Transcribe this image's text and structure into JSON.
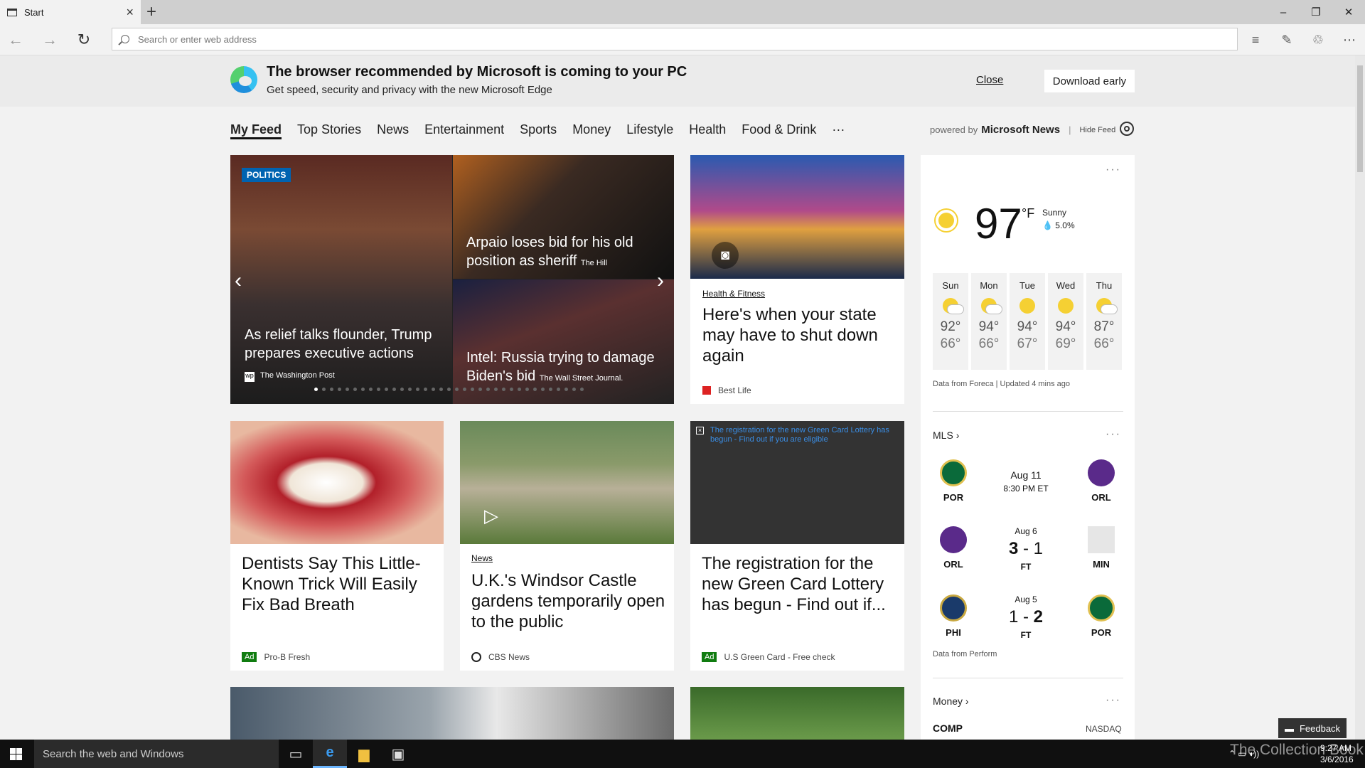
{
  "window": {
    "tab_title": "Start",
    "minimize": "–",
    "maximize": "❐",
    "close": "✕"
  },
  "address": {
    "placeholder": "Search or enter web address"
  },
  "banner": {
    "title": "The browser recommended by Microsoft is coming to your PC",
    "subtitle": "Get speed, security and privacy with the new Microsoft Edge",
    "close_label": "Close",
    "download_label": "Download early"
  },
  "feed_nav": {
    "items": [
      "My Feed",
      "Top Stories",
      "News",
      "Entertainment",
      "Sports",
      "Money",
      "Lifestyle",
      "Health",
      "Food & Drink",
      "···"
    ],
    "powered_by": "powered by",
    "provider": "Microsoft News",
    "hide_feed": "Hide Feed"
  },
  "hero": {
    "tag": "POLITICS",
    "main_caption": "As relief talks flounder, Trump prepares executive actions",
    "main_source": "The Washington Post",
    "top_caption": "Arpaio loses bid for his old position as sheriff",
    "top_source": "The Hill",
    "bottom_caption": "Intel: Russia trying to damage Biden's bid",
    "bottom_source": "The Wall Street Journal."
  },
  "cards": {
    "c1": {
      "category": "Health & Fitness",
      "headline": "Here's when your state may have to shut down again",
      "source": "Best Life"
    },
    "c2": {
      "ad": "Ad",
      "headline": "Dentists Say This Little-Known Trick Will Easily Fix Bad Breath",
      "source": "Pro-B Fresh"
    },
    "c3": {
      "category": "News",
      "headline": "U.K.'s Windsor Castle gardens temporarily open to the public",
      "source": "CBS News"
    },
    "c4": {
      "alt_text": "The registration for the new Green Card Lottery has begun - Find out if you are eligible",
      "ad": "Ad",
      "headline": "The registration for the new Green Card Lottery has begun - Find out if...",
      "source": "U.S Green Card - Free check"
    }
  },
  "weather": {
    "temp": "97",
    "unit": "°F",
    "condition": "Sunny",
    "precip": "5.0%",
    "forecast": [
      {
        "day": "Sun",
        "hi": "92°",
        "lo": "66°",
        "icon": "partly-cloudy-icon"
      },
      {
        "day": "Mon",
        "hi": "94°",
        "lo": "66°",
        "icon": "partly-cloudy-icon"
      },
      {
        "day": "Tue",
        "hi": "94°",
        "lo": "67°",
        "icon": "sunny-icon"
      },
      {
        "day": "Wed",
        "hi": "94°",
        "lo": "69°",
        "icon": "sunny-icon"
      },
      {
        "day": "Thu",
        "hi": "87°",
        "lo": "66°",
        "icon": "rain-icon"
      }
    ],
    "footnote": "Data from Foreca | Updated 4 mins ago"
  },
  "mls": {
    "title": "MLS",
    "matches": [
      {
        "home": "POR",
        "away": "ORL",
        "date": "Aug 11",
        "time": "8:30 PM ET"
      },
      {
        "home": "ORL",
        "away": "MIN",
        "date": "Aug 6",
        "home_score": "3",
        "away_score": "1",
        "status": "FT"
      },
      {
        "home": "PHI",
        "away": "POR",
        "date": "Aug 5",
        "home_score": "1",
        "away_score": "2",
        "status": "FT"
      }
    ],
    "footnote": "Data from Perform",
    "score_sep": "-"
  },
  "money": {
    "title": "Money",
    "symbol": "COMP",
    "exchange": "NASDAQ"
  },
  "feedback": "Feedback",
  "taskbar": {
    "search": "Search the web and Windows",
    "time": "9:27 AM",
    "date": "3/6/2016"
  },
  "watermark": "The Collection Book"
}
